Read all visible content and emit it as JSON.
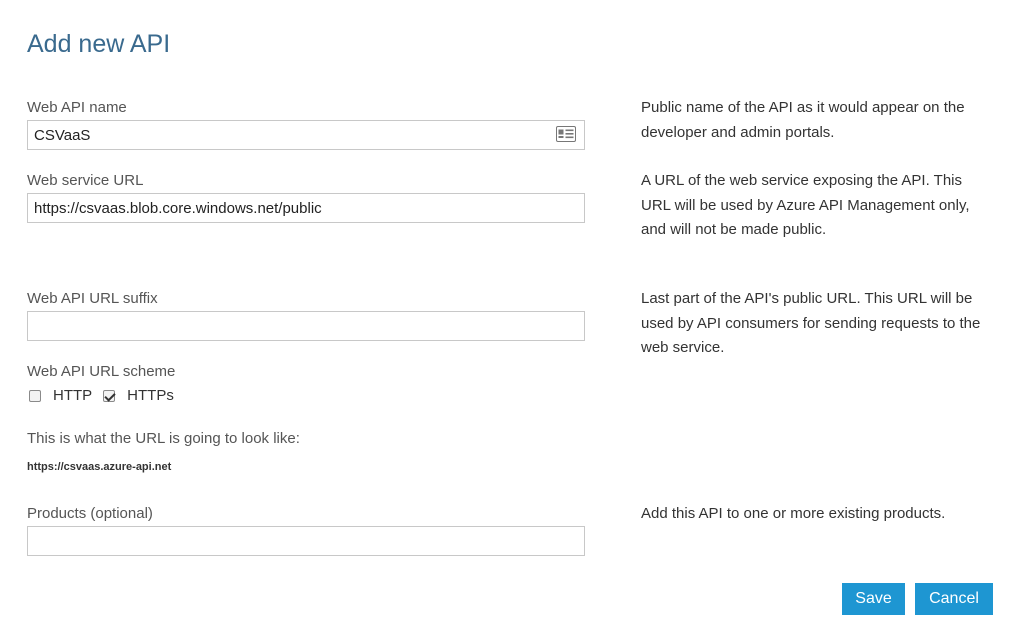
{
  "page": {
    "title": "Add new API"
  },
  "fields": {
    "name": {
      "label": "Web API name",
      "value": "CSVaaS",
      "help": "Public name of the API as it would appear on the developer and admin portals."
    },
    "service_url": {
      "label": "Web service URL",
      "value": "https://csvaas.blob.core.windows.net/public",
      "help": "A URL of the web service exposing the API. This URL will be used by Azure API Management only, and will not be made public."
    },
    "suffix": {
      "label": "Web API URL suffix",
      "value": "",
      "help": "Last part of the API's public URL. This URL will be used by API consumers for sending requests to the web service."
    },
    "scheme": {
      "label": "Web API URL scheme",
      "options": [
        {
          "label": "HTTP",
          "checked": false
        },
        {
          "label": "HTTPs",
          "checked": true
        }
      ]
    },
    "products": {
      "label": "Products (optional)",
      "value": "",
      "help": "Add this API to one or more existing products."
    }
  },
  "preview": {
    "label": "This is what the URL is going to look like:",
    "url": "https://csvaas.azure-api.net"
  },
  "buttons": {
    "save": "Save",
    "cancel": "Cancel"
  },
  "colors": {
    "title": "#3a6a8e",
    "button": "#1e96d2"
  }
}
